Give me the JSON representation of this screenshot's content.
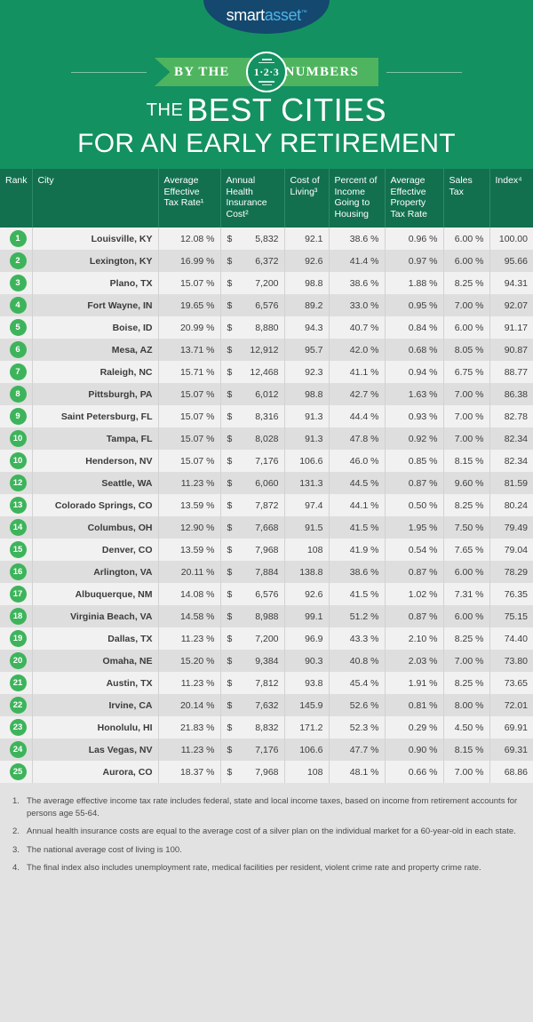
{
  "brand": {
    "logo_primary": "smart",
    "logo_secondary": "asset",
    "logo_tm": "™",
    "logo_bg": "#14486E",
    "accent_blue": "#4FB3E8"
  },
  "ribbon": {
    "left_word": "BY THE",
    "right_word": "NUMBERS",
    "badge_number": "1·2·3",
    "ribbon_color": "#4FB45F"
  },
  "header": {
    "title_the": "THE",
    "title_line1": "BEST CITIES",
    "title_line2": "FOR AN EARLY RETIREMENT",
    "bg_color": "#149161"
  },
  "table": {
    "header_bg": "#12704F",
    "rank_circle_color": "#3DB45B",
    "columns": [
      "Rank",
      "City",
      "Average Effective Tax Rate¹",
      "Annual Health Insurance Cost²",
      "Cost of Living³",
      "Percent of Income Going to Housing",
      "Average Effective Property Tax Rate",
      "Sales Tax",
      "Index⁴"
    ],
    "rows": [
      {
        "rank": "1",
        "city": "Louisville, KY",
        "tax": "12.08 %",
        "health": "5,832",
        "col": "92.1",
        "housing": "38.6 %",
        "property": "0.96 %",
        "sales": "6.00 %",
        "index": "100.00"
      },
      {
        "rank": "2",
        "city": "Lexington, KY",
        "tax": "16.99 %",
        "health": "6,372",
        "col": "92.6",
        "housing": "41.4 %",
        "property": "0.97 %",
        "sales": "6.00 %",
        "index": "95.66"
      },
      {
        "rank": "3",
        "city": "Plano, TX",
        "tax": "15.07 %",
        "health": "7,200",
        "col": "98.8",
        "housing": "38.6 %",
        "property": "1.88 %",
        "sales": "8.25 %",
        "index": "94.31"
      },
      {
        "rank": "4",
        "city": "Fort Wayne, IN",
        "tax": "19.65 %",
        "health": "6,576",
        "col": "89.2",
        "housing": "33.0 %",
        "property": "0.95 %",
        "sales": "7.00 %",
        "index": "92.07"
      },
      {
        "rank": "5",
        "city": "Boise, ID",
        "tax": "20.99 %",
        "health": "8,880",
        "col": "94.3",
        "housing": "40.7 %",
        "property": "0.84 %",
        "sales": "6.00 %",
        "index": "91.17"
      },
      {
        "rank": "6",
        "city": "Mesa, AZ",
        "tax": "13.71 %",
        "health": "12,912",
        "col": "95.7",
        "housing": "42.0 %",
        "property": "0.68 %",
        "sales": "8.05 %",
        "index": "90.87"
      },
      {
        "rank": "7",
        "city": "Raleigh, NC",
        "tax": "15.71 %",
        "health": "12,468",
        "col": "92.3",
        "housing": "41.1 %",
        "property": "0.94 %",
        "sales": "6.75 %",
        "index": "88.77"
      },
      {
        "rank": "8",
        "city": "Pittsburgh, PA",
        "tax": "15.07 %",
        "health": "6,012",
        "col": "98.8",
        "housing": "42.7 %",
        "property": "1.63 %",
        "sales": "7.00 %",
        "index": "86.38"
      },
      {
        "rank": "9",
        "city": "Saint Petersburg, FL",
        "tax": "15.07 %",
        "health": "8,316",
        "col": "91.3",
        "housing": "44.4 %",
        "property": "0.93 %",
        "sales": "7.00 %",
        "index": "82.78"
      },
      {
        "rank": "10",
        "city": "Tampa, FL",
        "tax": "15.07 %",
        "health": "8,028",
        "col": "91.3",
        "housing": "47.8 %",
        "property": "0.92 %",
        "sales": "7.00 %",
        "index": "82.34"
      },
      {
        "rank": "10",
        "city": "Henderson, NV",
        "tax": "15.07 %",
        "health": "7,176",
        "col": "106.6",
        "housing": "46.0 %",
        "property": "0.85 %",
        "sales": "8.15 %",
        "index": "82.34"
      },
      {
        "rank": "12",
        "city": "Seattle, WA",
        "tax": "11.23 %",
        "health": "6,060",
        "col": "131.3",
        "housing": "44.5 %",
        "property": "0.87 %",
        "sales": "9.60 %",
        "index": "81.59"
      },
      {
        "rank": "13",
        "city": "Colorado Springs, CO",
        "tax": "13.59 %",
        "health": "7,872",
        "col": "97.4",
        "housing": "44.1 %",
        "property": "0.50 %",
        "sales": "8.25 %",
        "index": "80.24"
      },
      {
        "rank": "14",
        "city": "Columbus, OH",
        "tax": "12.90 %",
        "health": "7,668",
        "col": "91.5",
        "housing": "41.5 %",
        "property": "1.95 %",
        "sales": "7.50 %",
        "index": "79.49"
      },
      {
        "rank": "15",
        "city": "Denver, CO",
        "tax": "13.59 %",
        "health": "7,968",
        "col": "108",
        "housing": "41.9 %",
        "property": "0.54 %",
        "sales": "7.65 %",
        "index": "79.04"
      },
      {
        "rank": "16",
        "city": "Arlington, VA",
        "tax": "20.11 %",
        "health": "7,884",
        "col": "138.8",
        "housing": "38.6 %",
        "property": "0.87 %",
        "sales": "6.00 %",
        "index": "78.29"
      },
      {
        "rank": "17",
        "city": "Albuquerque, NM",
        "tax": "14.08 %",
        "health": "6,576",
        "col": "92.6",
        "housing": "41.5 %",
        "property": "1.02 %",
        "sales": "7.31 %",
        "index": "76.35"
      },
      {
        "rank": "18",
        "city": "Virginia Beach, VA",
        "tax": "14.58 %",
        "health": "8,988",
        "col": "99.1",
        "housing": "51.2 %",
        "property": "0.87 %",
        "sales": "6.00 %",
        "index": "75.15"
      },
      {
        "rank": "19",
        "city": "Dallas, TX",
        "tax": "11.23 %",
        "health": "7,200",
        "col": "96.9",
        "housing": "43.3 %",
        "property": "2.10 %",
        "sales": "8.25 %",
        "index": "74.40"
      },
      {
        "rank": "20",
        "city": "Omaha, NE",
        "tax": "15.20 %",
        "health": "9,384",
        "col": "90.3",
        "housing": "40.8 %",
        "property": "2.03 %",
        "sales": "7.00 %",
        "index": "73.80"
      },
      {
        "rank": "21",
        "city": "Austin, TX",
        "tax": "11.23 %",
        "health": "7,812",
        "col": "93.8",
        "housing": "45.4 %",
        "property": "1.91 %",
        "sales": "8.25 %",
        "index": "73.65"
      },
      {
        "rank": "22",
        "city": "Irvine, CA",
        "tax": "20.14 %",
        "health": "7,632",
        "col": "145.9",
        "housing": "52.6 %",
        "property": "0.81 %",
        "sales": "8.00 %",
        "index": "72.01"
      },
      {
        "rank": "23",
        "city": "Honolulu, HI",
        "tax": "21.83 %",
        "health": "8,832",
        "col": "171.2",
        "housing": "52.3 %",
        "property": "0.29 %",
        "sales": "4.50 %",
        "index": "69.91"
      },
      {
        "rank": "24",
        "city": "Las Vegas, NV",
        "tax": "11.23 %",
        "health": "7,176",
        "col": "106.6",
        "housing": "47.7 %",
        "property": "0.90 %",
        "sales": "8.15 %",
        "index": "69.31"
      },
      {
        "rank": "25",
        "city": "Aurora, CO",
        "tax": "18.37 %",
        "health": "7,968",
        "col": "108",
        "housing": "48.1 %",
        "property": "0.66 %",
        "sales": "7.00 %",
        "index": "68.86"
      }
    ],
    "currency_symbol": "$"
  },
  "footnotes": [
    {
      "num": "1.",
      "text": "The average effective income tax rate includes federal, state and local income taxes, based on income from retirement accounts for persons age 55-64."
    },
    {
      "num": "2.",
      "text": "Annual health insurance costs are equal to the average cost of a silver plan on the individual market for a 60-year-old in each state."
    },
    {
      "num": "3.",
      "text": "The national average cost of living is 100."
    },
    {
      "num": "4.",
      "text": "The final index also includes unemployment rate, medical facilities per resident, violent crime rate and property crime rate."
    }
  ]
}
